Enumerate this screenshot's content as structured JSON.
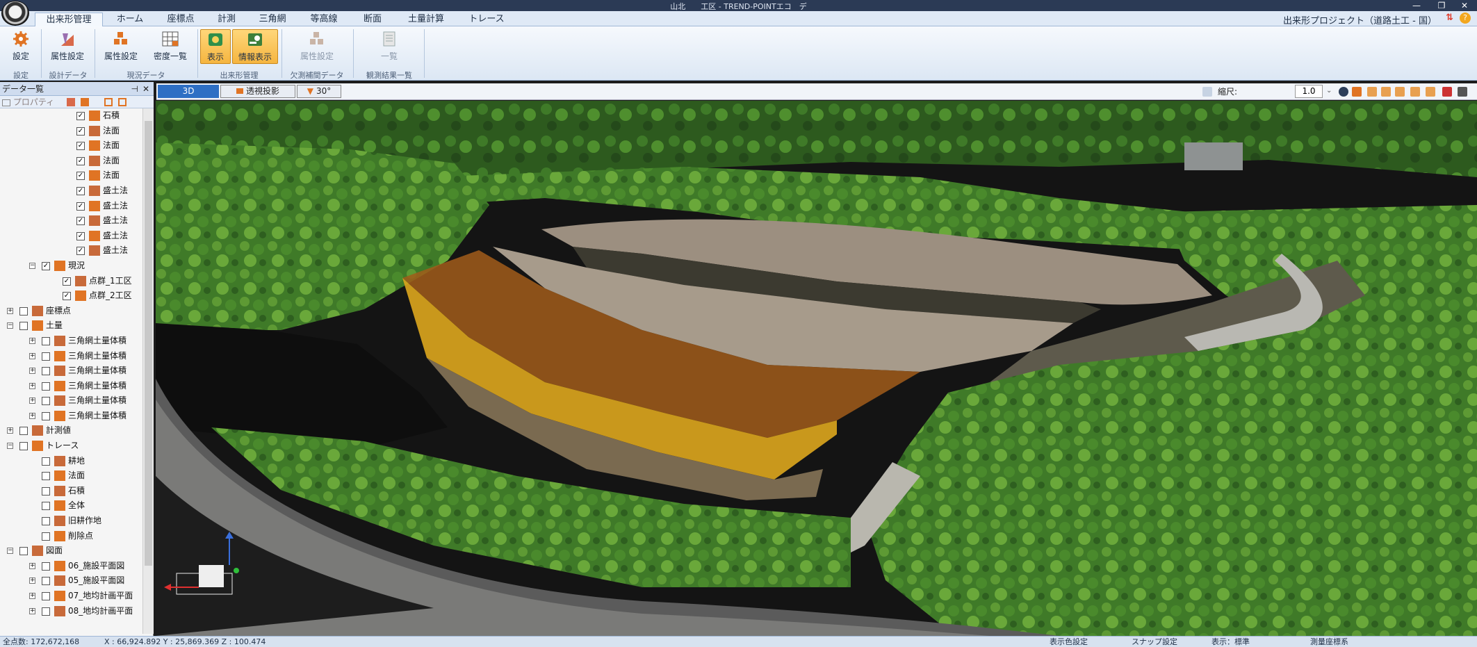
{
  "window": {
    "title": "山北　　工区 - TREND-POINTエコ　デ"
  },
  "tabs": [
    {
      "label": "出来形管理",
      "active": true
    },
    {
      "label": "ホーム"
    },
    {
      "label": "座標点"
    },
    {
      "label": "計測"
    },
    {
      "label": "三角網"
    },
    {
      "label": "等高線"
    },
    {
      "label": "断面"
    },
    {
      "label": "土量計算"
    },
    {
      "label": "トレース"
    }
  ],
  "project_name": "出来形プロジェクト（道路土工 - 国）",
  "ribbon": {
    "buttons": [
      {
        "label": "設定",
        "icon": "gear-icon"
      },
      {
        "label": "属性設定",
        "icon": "design-attribute-icon"
      },
      {
        "label": "属性設定",
        "icon": "survey-attribute-icon"
      },
      {
        "label": "密度一覧",
        "icon": "density-grid-icon"
      },
      {
        "label": "表示",
        "icon": "display-icon"
      },
      {
        "label": "情報表示",
        "icon": "info-display-icon"
      },
      {
        "label": "属性設定",
        "icon": "missing-attribute-icon"
      },
      {
        "label": "一覧",
        "icon": "result-list-icon"
      }
    ],
    "groups": [
      "設定",
      "設計データ",
      "現況データ",
      "出来形管理",
      "欠測補間データ",
      "観測結果一覧"
    ]
  },
  "panel": {
    "title": "データ一覧",
    "toolbar_label": "プロパティ",
    "tree": [
      {
        "label": "石積",
        "checked": true,
        "level": 3
      },
      {
        "label": "法面",
        "checked": true,
        "level": 3
      },
      {
        "label": "法面",
        "checked": true,
        "level": 3
      },
      {
        "label": "法面",
        "checked": true,
        "level": 3
      },
      {
        "label": "法面",
        "checked": true,
        "level": 3
      },
      {
        "label": "盛土法",
        "checked": true,
        "level": 3
      },
      {
        "label": "盛土法",
        "checked": true,
        "level": 3
      },
      {
        "label": "盛土法",
        "checked": true,
        "level": 3
      },
      {
        "label": "盛土法",
        "checked": true,
        "level": 3
      },
      {
        "label": "盛土法",
        "checked": true,
        "level": 3
      },
      {
        "label": "現況",
        "checked": true,
        "level": 1,
        "expand": "−"
      },
      {
        "label": "点群_1工区",
        "checked": true,
        "level": 2
      },
      {
        "label": "点群_2工区",
        "checked": true,
        "level": 2
      },
      {
        "label": "座標点",
        "checked": false,
        "level": 0,
        "expand": "+"
      },
      {
        "label": "土量",
        "checked": false,
        "level": 0,
        "expand": "−"
      },
      {
        "label": "三角網土量体積",
        "checked": false,
        "level": 1,
        "expand": "+"
      },
      {
        "label": "三角網土量体積",
        "checked": false,
        "level": 1,
        "expand": "+"
      },
      {
        "label": "三角網土量体積",
        "checked": false,
        "level": 1,
        "expand": "+"
      },
      {
        "label": "三角網土量体積",
        "checked": false,
        "level": 1,
        "expand": "+"
      },
      {
        "label": "三角網土量体積",
        "checked": false,
        "level": 1,
        "expand": "+"
      },
      {
        "label": "三角網土量体積",
        "checked": false,
        "level": 1,
        "expand": "+"
      },
      {
        "label": "計測値",
        "checked": false,
        "level": 0,
        "expand": "+"
      },
      {
        "label": "トレース",
        "checked": false,
        "level": 0,
        "expand": "−"
      },
      {
        "label": "耕地",
        "checked": false,
        "level": 1
      },
      {
        "label": "法面",
        "checked": false,
        "level": 1
      },
      {
        "label": "石積",
        "checked": false,
        "level": 1
      },
      {
        "label": "全体",
        "checked": false,
        "level": 1
      },
      {
        "label": "旧耕作地",
        "checked": false,
        "level": 1
      },
      {
        "label": "削除点",
        "checked": false,
        "level": 1
      },
      {
        "label": "図面",
        "checked": false,
        "level": 0,
        "expand": "−"
      },
      {
        "label": "06_施設平面図",
        "checked": false,
        "level": 1,
        "expand": "+"
      },
      {
        "label": "05_施設平面図",
        "checked": false,
        "level": 1,
        "expand": "+"
      },
      {
        "label": "07_地均計画平面",
        "checked": false,
        "level": 1,
        "expand": "+"
      },
      {
        "label": "08_地均計画平面",
        "checked": false,
        "level": 1,
        "expand": "+"
      }
    ]
  },
  "view_toolbar": {
    "mode_3d": "3D",
    "projection": "透視投影",
    "angle": "30°",
    "scale_label": "縮尺:",
    "scale_value": "1.0"
  },
  "status": {
    "point_count": "全点数: 172,672,168",
    "coordinates": "X : 66,924.892  Y : 25,869.369  Z : 100.474",
    "display_color": "表示色設定",
    "snap": "スナップ設定",
    "display_mode": "表示：標準",
    "survey_coords": "測量座標系"
  },
  "colors": {
    "ribbon_active": "#f5b540",
    "tab_bg": "#dfe9f6",
    "titlebar": "#2b3a55"
  }
}
